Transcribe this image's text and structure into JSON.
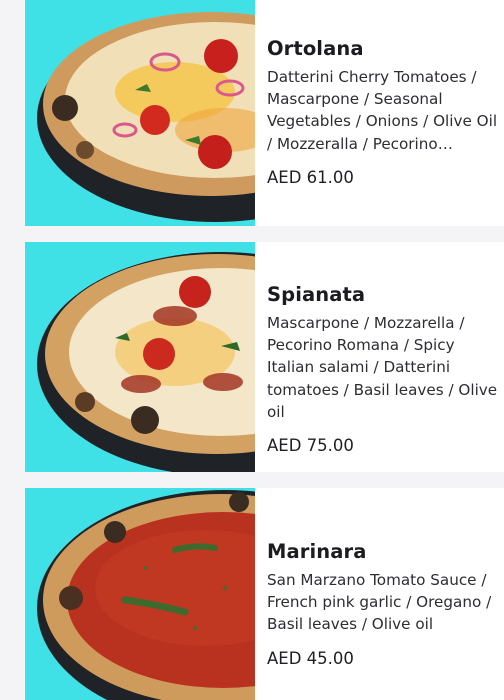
{
  "menu": {
    "items": [
      {
        "name": "Ortolana",
        "description": "Datterini Cherry Tomatoes / Mascarpone / Seasonal Vegetables / Onions / Olive Oil / Mozzeralla / Pecorino Romano / Basil leaves",
        "price": "AED 61.00",
        "image": "ortolana-pizza-photo"
      },
      {
        "name": "Spianata",
        "description": "Mascarpone / Mozzarella / Pecorino Romana / Spicy Italian salami / Datterini tomatoes / Basil leaves / Olive oil",
        "price": "AED 75.00",
        "image": "spianata-pizza-photo"
      },
      {
        "name": "Marinara",
        "description": "San Marzano Tomato Sauce / French pink garlic / Oregano / Basil leaves / Olive oil",
        "price": "AED 45.00",
        "image": "marinara-pizza-photo"
      }
    ]
  },
  "colors": {
    "photo_background": "#3fe0e6",
    "card_background": "#ffffff",
    "page_background": "#f4f4f6"
  }
}
